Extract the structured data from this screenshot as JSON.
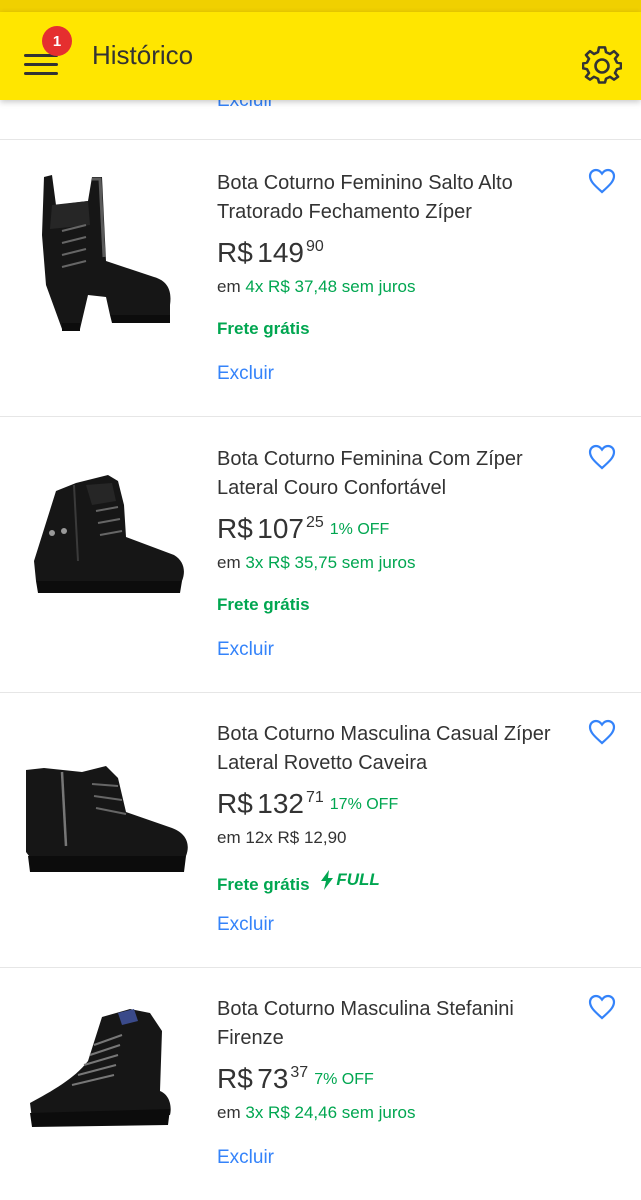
{
  "header": {
    "title": "Histórico",
    "notification_count": "1",
    "bg_color": "#ffe600"
  },
  "previous_item": {
    "remove_label": "Excluir"
  },
  "products": [
    {
      "title": "Bota Coturno Feminino Salto Alto Tratorado Fechamento Zíper",
      "currency": "R$",
      "price_int": "149",
      "price_cents": "90",
      "discount": "",
      "installment_prefix": "em",
      "installment_text": "4x R$ 37,48 sem juros",
      "installment_free_interest": true,
      "shipping": "Frete grátis",
      "full_badge": "",
      "remove_label": "Excluir",
      "image": "heeled-lace-up-boot"
    },
    {
      "title": "Bota Coturno Feminina Com Zíper Lateral Couro Confortável",
      "currency": "R$",
      "price_int": "107",
      "price_cents": "25",
      "discount": "1% OFF",
      "installment_prefix": "em",
      "installment_text": "3x R$ 35,75 sem juros",
      "installment_free_interest": true,
      "shipping": "Frete grátis",
      "full_badge": "",
      "remove_label": "Excluir",
      "image": "flat-lace-up-boot"
    },
    {
      "title": "Bota Coturno Masculina Casual Zíper Lateral Rovetto Caveira",
      "currency": "R$",
      "price_int": "132",
      "price_cents": "71",
      "discount": "17% OFF",
      "installment_prefix": "em",
      "installment_text": "12x R$ 12,90",
      "installment_free_interest": false,
      "shipping": "Frete grátis",
      "full_badge": "FULL",
      "remove_label": "Excluir",
      "image": "mens-zip-boot"
    },
    {
      "title": "Bota Coturno Masculina Stefanini Firenze",
      "currency": "R$",
      "price_int": "73",
      "price_cents": "37",
      "discount": "7% OFF",
      "installment_prefix": "em",
      "installment_text": "3x R$ 24,46 sem juros",
      "installment_free_interest": true,
      "shipping": "",
      "full_badge": "",
      "remove_label": "Excluir",
      "image": "mens-hiking-boot"
    }
  ],
  "colors": {
    "accent_green": "#00a650",
    "link_blue": "#3483fa",
    "badge_red": "#e52f2f"
  }
}
